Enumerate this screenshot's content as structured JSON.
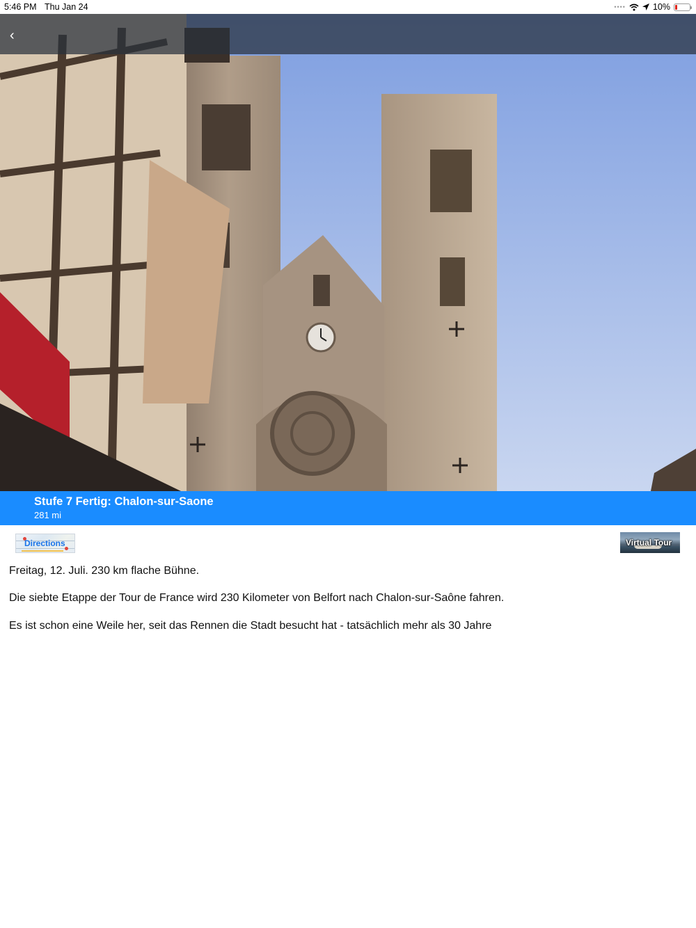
{
  "status_bar": {
    "time": "5:46 PM",
    "date": "Thu Jan 24",
    "battery": "10%"
  },
  "header": {
    "back_icon": "chevron-left-icon"
  },
  "hero": {
    "subject": "cathedral-photo"
  },
  "stage": {
    "title": "Stufe 7 Fertig: Chalon-sur-Saone",
    "distance": "281 mi"
  },
  "actions": {
    "directions_label": "Directions",
    "virtual_tour_label": "Virtual Tour"
  },
  "content": {
    "paragraphs": [
      "Freitag, 12. Juli. 230 km flache Bühne.",
      "Die siebte Etappe der Tour de France wird 230 Kilometer von Belfort nach Chalon-sur-Saône fahren.",
      "Es ist schon eine Weile her, seit das Rennen die Stadt besucht hat - tatsächlich mehr als 30 Jahre"
    ]
  },
  "colors": {
    "accent": "#1a8cff",
    "battery_low": "#e0261b"
  }
}
